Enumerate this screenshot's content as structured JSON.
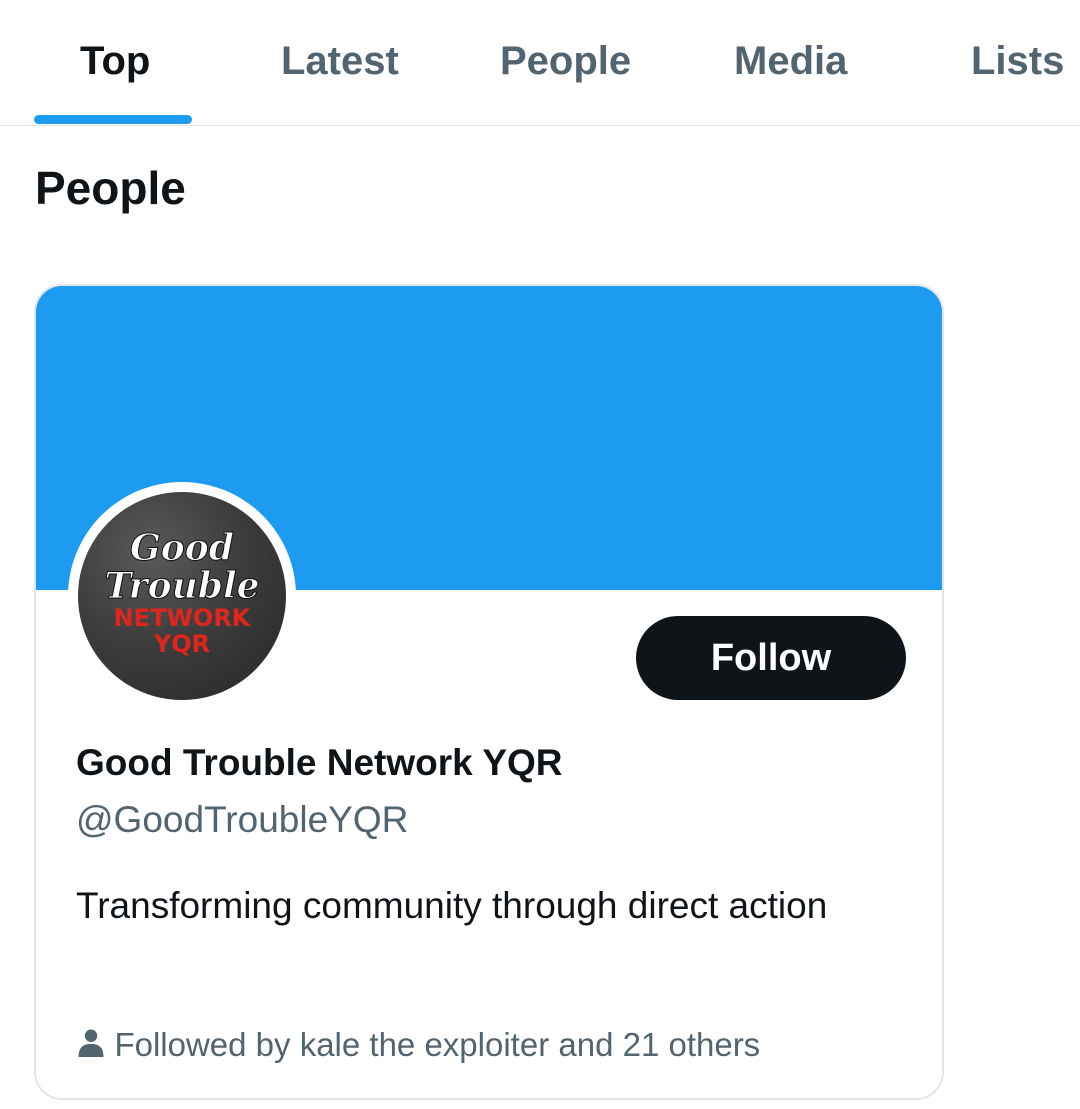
{
  "tabs": [
    {
      "label": "Top",
      "active": true
    },
    {
      "label": "Latest",
      "active": false
    },
    {
      "label": "People",
      "active": false
    },
    {
      "label": "Media",
      "active": false
    },
    {
      "label": "Lists",
      "active": false
    }
  ],
  "section": {
    "title": "People"
  },
  "user_card": {
    "avatar_text": {
      "line1": "Good",
      "line2": "Trouble",
      "line3": "NETWORK",
      "line4": "YQR"
    },
    "follow_label": "Follow",
    "display_name": "Good Trouble Network YQR",
    "handle": "@GoodTroubleYQR",
    "bio": "Transforming community through direct action",
    "followed_by": "Followed by kale the exploiter and 21 others"
  },
  "colors": {
    "accent": "#1d9bf0",
    "primary_text": "#0f1419",
    "secondary_text": "#536471",
    "follow_button": "#0f1419",
    "logo_red": "#e0261c"
  },
  "icons": {
    "followed_by": "person-icon"
  }
}
